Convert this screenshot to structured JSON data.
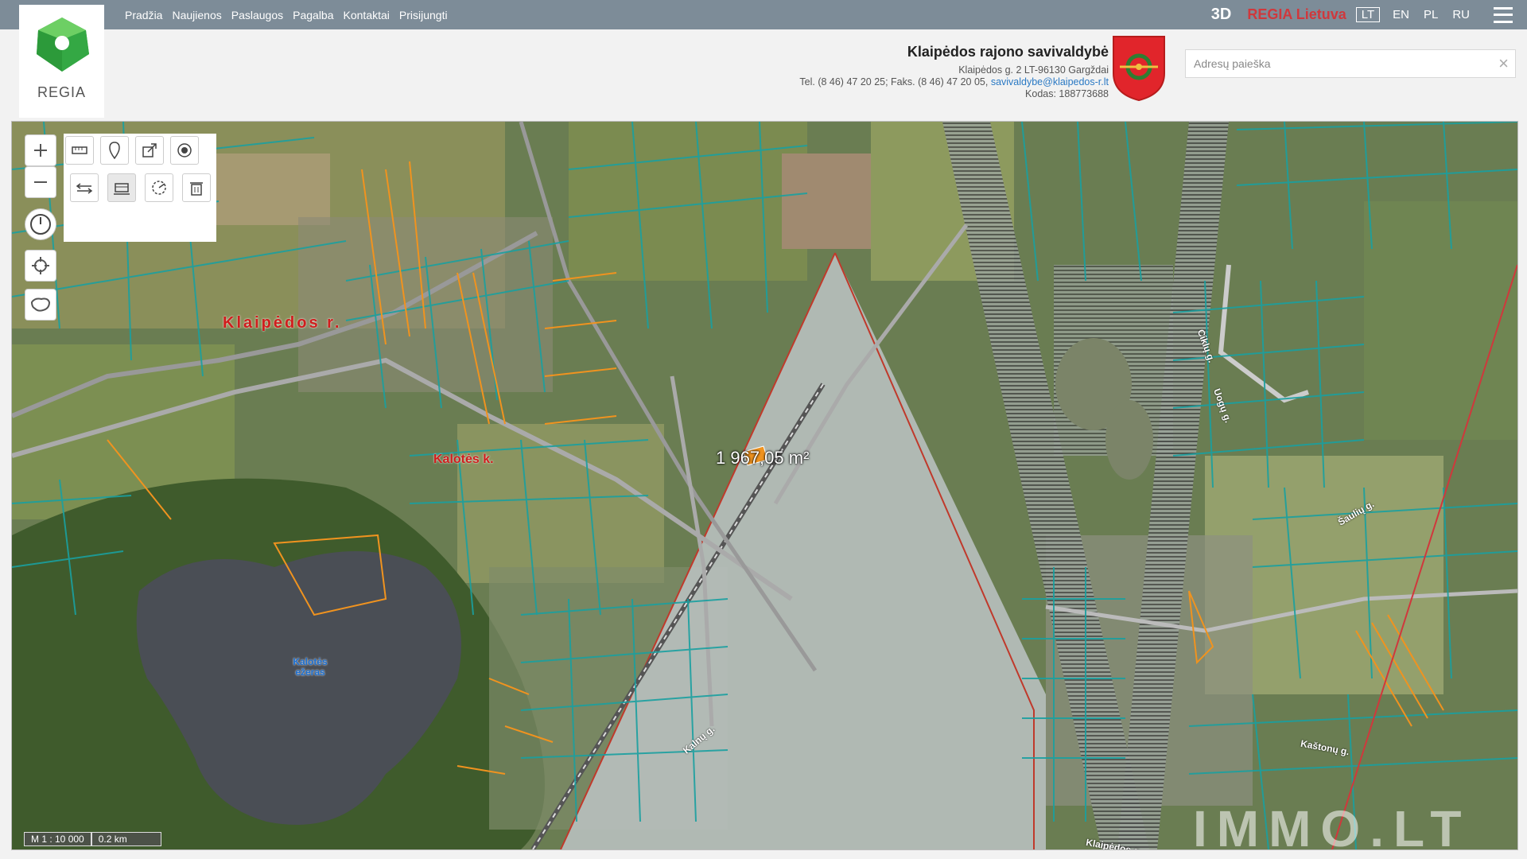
{
  "nav": {
    "items": [
      "Pradžia",
      "Naujienos",
      "Paslaugos",
      "Pagalba",
      "Kontaktai",
      "Prisijungti"
    ]
  },
  "brand": {
    "logo_text": "REGIA"
  },
  "topright": {
    "view3d": "3D",
    "regia_lt": "REGIA Lietuva",
    "languages": [
      "LT",
      "EN",
      "PL",
      "RU"
    ],
    "active_language": "LT"
  },
  "municipality": {
    "name": "Klaipėdos rajono savivaldybė",
    "address": "Klaipėdos g. 2 LT-96130 Gargždai",
    "phone": "Tel. (8 46) 47 20 25; Faks. (8 46) 47 20 05, ",
    "email": "savivaldybe@klaipedos-r.lt",
    "code": "Kodas: 188773688"
  },
  "search": {
    "placeholder": "Adresų paieška",
    "value": "",
    "clear": "×"
  },
  "map": {
    "area_label": "1 967,05 m²",
    "place_labels": {
      "klaipedos": "Klaipėdos r.",
      "kalotes": "Kalotės k.",
      "lake": "Kalotės ežeras"
    },
    "streets": [
      "Ciklų g.",
      "Uogų g.",
      "Šaulių g.",
      "Kalnų g.",
      "Kaštonų g.",
      "Klaipėdos g."
    ],
    "scale": {
      "ratio": "M 1 : 10 000",
      "distance": "0.2 km"
    },
    "watermark": "IMMO.LT"
  },
  "colors": {
    "topbar": "#7d8c98",
    "parcel": "#1aa0a0",
    "orange": "#f0931f",
    "border_red": "#c0392b",
    "accent_red": "#d0383c",
    "link": "#2a79c4"
  }
}
